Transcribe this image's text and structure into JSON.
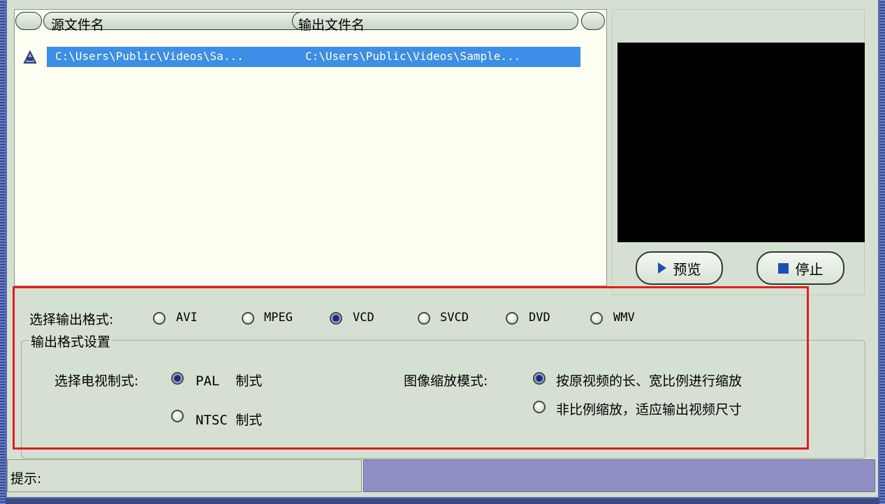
{
  "file_list": {
    "columns": [
      "源文件名",
      "输出文件名"
    ],
    "rows": [
      {
        "source": "C:\\Users\\Public\\Videos\\Sa...",
        "output": "C:\\Users\\Public\\Videos\\Sample..."
      }
    ]
  },
  "preview": {
    "preview_label": "预览",
    "stop_label": "停止"
  },
  "output_format": {
    "label": "选择输出格式:",
    "options": [
      "AVI",
      "MPEG",
      "VCD",
      "SVCD",
      "DVD",
      "WMV"
    ],
    "selected": "VCD"
  },
  "settings": {
    "group_title": "输出格式设置",
    "tv_system_label": "选择电视制式:",
    "tv_options": [
      "PAL  制式",
      "NTSC 制式"
    ],
    "tv_selected": "PAL  制式",
    "scale_label": "图像缩放模式:",
    "scale_options": [
      "按原视频的长、宽比例进行缩放",
      "非比例缩放，适应输出视频尺寸"
    ],
    "scale_selected": "按原视频的长、宽比例进行缩放"
  },
  "status": {
    "hint_label": "提示:",
    "hint_text": ""
  },
  "colors": {
    "highlight": "#e31c1c",
    "selection": "#3d8ee6",
    "radio_selected": "#1c2a7a"
  }
}
